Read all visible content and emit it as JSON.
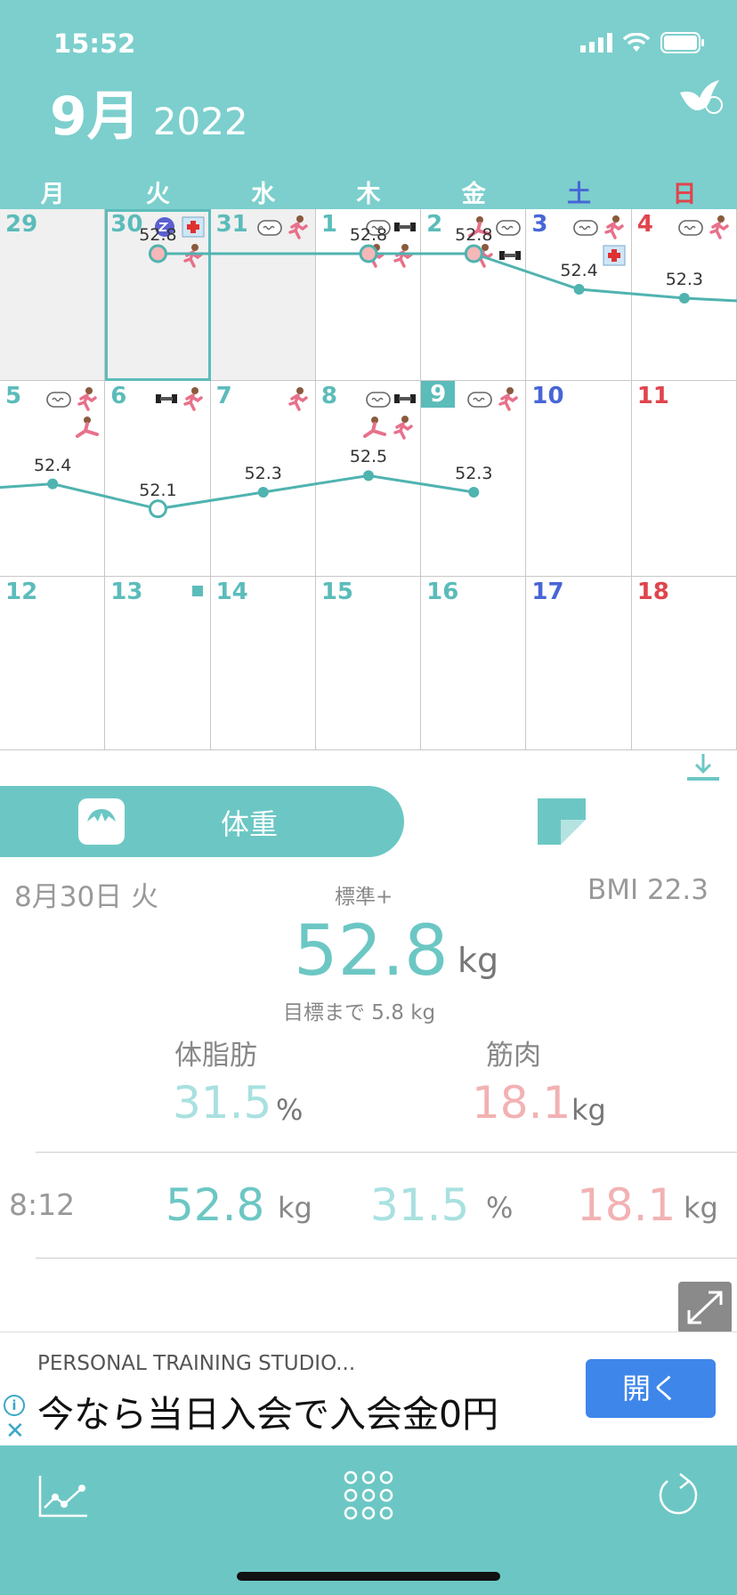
{
  "status_bar": {
    "time": "15:52"
  },
  "header": {
    "month": "9月",
    "year": "2022"
  },
  "weekdays": [
    "月",
    "火",
    "水",
    "木",
    "金",
    "土",
    "日"
  ],
  "calendar": {
    "weeks": [
      [
        {
          "day": "29",
          "weight": null
        },
        {
          "day": "30",
          "weight": "52.8"
        },
        {
          "day": "31",
          "weight": null
        },
        {
          "day": "1",
          "weight": "52.8"
        },
        {
          "day": "2",
          "weight": "52.8"
        },
        {
          "day": "3",
          "weight": "52.4"
        },
        {
          "day": "4",
          "weight": "52.3"
        }
      ],
      [
        {
          "day": "5",
          "weight": "52.4"
        },
        {
          "day": "6",
          "weight": "52.1"
        },
        {
          "day": "7",
          "weight": "52.3"
        },
        {
          "day": "8",
          "weight": "52.5"
        },
        {
          "day": "9",
          "weight": "52.3"
        },
        {
          "day": "10",
          "weight": null
        },
        {
          "day": "11",
          "weight": null
        }
      ],
      [
        {
          "day": "12"
        },
        {
          "day": "13"
        },
        {
          "day": "14"
        },
        {
          "day": "15"
        },
        {
          "day": "16"
        },
        {
          "day": "17"
        },
        {
          "day": "18"
        }
      ]
    ]
  },
  "tabs": {
    "active_label": "体重"
  },
  "detail": {
    "date": "8月30日 火",
    "category": "標準+",
    "bmi": "BMI 22.3",
    "weight": "52.8",
    "weight_unit": "kg",
    "goal_text": "目標まで 5.8 kg",
    "body_fat_label": "体脂肪",
    "muscle_label": "筋肉",
    "body_fat_value": "31.5",
    "body_fat_unit": "%",
    "muscle_value": "18.1",
    "muscle_unit": "kg"
  },
  "record": {
    "time": "8:12",
    "weight": "52.8",
    "weight_unit": "kg",
    "fat": "31.5",
    "fat_unit": "%",
    "muscle": "18.1",
    "muscle_unit": "kg"
  },
  "ad": {
    "subtitle": "PERSONAL TRAINING STUDIO...",
    "headline": "今なら当日入会で入会金0円",
    "button": "開く",
    "info": "i",
    "close": "✕"
  },
  "colors": {
    "header_bg": "#7ccfcd",
    "accent": "#6cc7c4",
    "fat": "#a8e1e0",
    "muscle": "#f2b2b3",
    "saturday": "#4866d6",
    "sunday": "#e0454d",
    "ad_button": "#3f86eb"
  }
}
